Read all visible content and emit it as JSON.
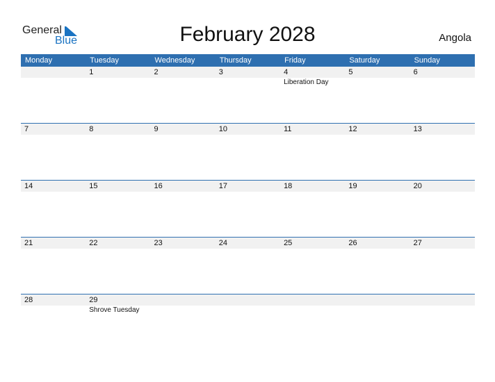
{
  "logo": {
    "general": "General",
    "blue": "Blue"
  },
  "title": "February 2028",
  "country": "Angola",
  "colors": {
    "accent": "#2e6fb0",
    "band": "#f1f1f1",
    "logo_blue": "#1a73c2"
  },
  "weekdays": [
    "Monday",
    "Tuesday",
    "Wednesday",
    "Thursday",
    "Friday",
    "Saturday",
    "Sunday"
  ],
  "weeks": [
    [
      {
        "d": ""
      },
      {
        "d": "1"
      },
      {
        "d": "2"
      },
      {
        "d": "3"
      },
      {
        "d": "4",
        "ev": "Liberation Day"
      },
      {
        "d": "5"
      },
      {
        "d": "6"
      }
    ],
    [
      {
        "d": "7"
      },
      {
        "d": "8"
      },
      {
        "d": "9"
      },
      {
        "d": "10"
      },
      {
        "d": "11"
      },
      {
        "d": "12"
      },
      {
        "d": "13"
      }
    ],
    [
      {
        "d": "14"
      },
      {
        "d": "15"
      },
      {
        "d": "16"
      },
      {
        "d": "17"
      },
      {
        "d": "18"
      },
      {
        "d": "19"
      },
      {
        "d": "20"
      }
    ],
    [
      {
        "d": "21"
      },
      {
        "d": "22"
      },
      {
        "d": "23"
      },
      {
        "d": "24"
      },
      {
        "d": "25"
      },
      {
        "d": "26"
      },
      {
        "d": "27"
      }
    ],
    [
      {
        "d": "28"
      },
      {
        "d": "29",
        "ev": "Shrove Tuesday"
      },
      {
        "d": ""
      },
      {
        "d": ""
      },
      {
        "d": ""
      },
      {
        "d": ""
      },
      {
        "d": ""
      }
    ]
  ]
}
